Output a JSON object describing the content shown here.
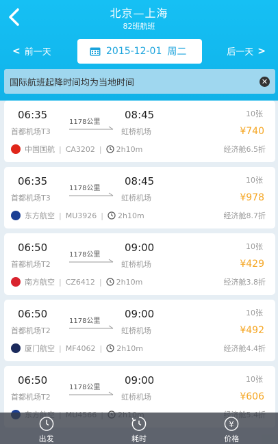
{
  "header": {
    "title": "北京—上海",
    "subtitle": "82班航班"
  },
  "datebar": {
    "prev_label": "前一天",
    "next_label": "后一天",
    "date": "2015-12-01",
    "weekday": "周二"
  },
  "notice": {
    "text": "国际航班起降时间均为当地时间"
  },
  "flights": [
    {
      "dep_time": "06:35",
      "arr_time": "08:45",
      "distance": "1178公里",
      "dep_airport": "首都机场T3",
      "arr_airport": "虹桥机场",
      "airline": "中国国航",
      "flight_no": "CA3202",
      "duration": "2h10m",
      "seats": "10张",
      "price": "¥740",
      "cabin": "经济舱6.5折",
      "logo_color": "#e0261a"
    },
    {
      "dep_time": "06:35",
      "arr_time": "08:45",
      "distance": "1178公里",
      "dep_airport": "首都机场T3",
      "arr_airport": "虹桥机场",
      "airline": "东方航空",
      "flight_no": "MU3926",
      "duration": "2h10m",
      "seats": "10张",
      "price": "¥978",
      "cabin": "经济舱8.7折",
      "logo_color": "#1c3f94"
    },
    {
      "dep_time": "06:50",
      "arr_time": "09:00",
      "distance": "1178公里",
      "dep_airport": "首都机场T2",
      "arr_airport": "虹桥机场",
      "airline": "南方航空",
      "flight_no": "CZ6412",
      "duration": "2h10m",
      "seats": "10张",
      "price": "¥429",
      "cabin": "经济舱3.8折",
      "logo_color": "#d9232e"
    },
    {
      "dep_time": "06:50",
      "arr_time": "09:00",
      "distance": "1178公里",
      "dep_airport": "首都机场T2",
      "arr_airport": "虹桥机场",
      "airline": "厦门航空",
      "flight_no": "MF4062",
      "duration": "2h10m",
      "seats": "10张",
      "price": "¥492",
      "cabin": "经济舱4.4折",
      "logo_color": "#1b2a5c"
    },
    {
      "dep_time": "06:50",
      "arr_time": "09:00",
      "distance": "1178公里",
      "dep_airport": "首都机场T2",
      "arr_airport": "虹桥机场",
      "airline": "东方航空",
      "flight_no": "MU4566",
      "duration": "2h10m",
      "seats": "10张",
      "price": "¥606",
      "cabin": "经济舱5.4折",
      "logo_color": "#1c3f94"
    }
  ],
  "tabbar": {
    "departure_label": "出发",
    "duration_label": "耗时",
    "price_label": "价格",
    "price_icon_glyph": "¥"
  },
  "colors": {
    "header": "#12b8ee",
    "price": "#f5a623",
    "notice_bg": "#9fd7ef"
  }
}
